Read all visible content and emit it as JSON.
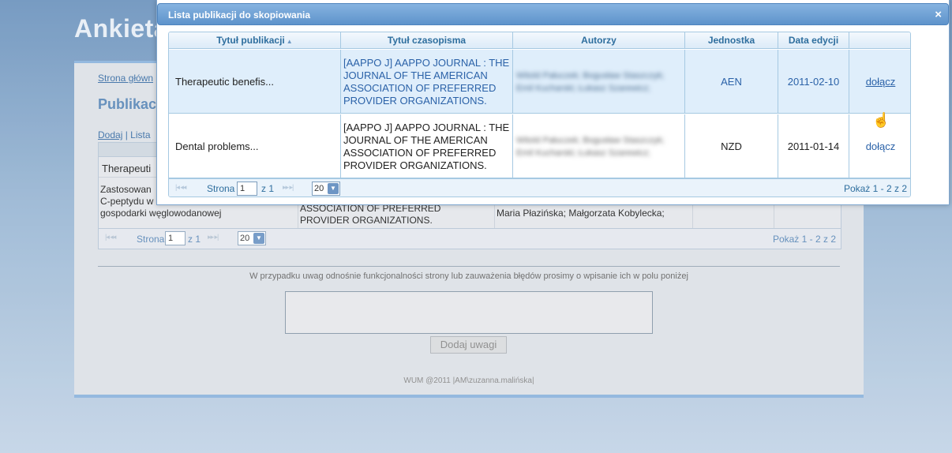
{
  "background": {
    "app_title": "Ankieta",
    "breadcrumb": "Strona główn",
    "heading": "Publikac",
    "links": {
      "add": "Dodaj",
      "separator": "|",
      "list": "Lista"
    },
    "row1_text": "Therapeuti",
    "row2": {
      "col1": "Zastosowan\nC-peptydu w\ngospodarki węglowodanowej",
      "col2": "ASSOCIATION OF PREFERRED PROVIDER ORGANIZATIONS.",
      "col3": "Maria Płazińska; Małgorzata Kobylecka;"
    },
    "pager": {
      "page_label": "Strona",
      "page_value": "1",
      "of_label": "z 1",
      "page_size": "20",
      "summary": "Pokaż 1 - 2 z 2"
    },
    "feedback_note": "W przypadku uwag odnośnie funkcjonalności strony lub zauważenia błędów prosimy o wpisanie ich w polu poniżej",
    "feedback_button": "Dodaj uwagi",
    "footer": "WUM @2011  |AM\\zuzanna.malińska|"
  },
  "dialog": {
    "title": "Lista publikacji do skopiowania",
    "close_glyph": "×",
    "columns": [
      "Tytuł publikacji",
      "Tytuł czasopisma",
      "Autorzy",
      "Jednostka",
      "Data edycji",
      ""
    ],
    "sort_glyph": "▲",
    "rows": [
      {
        "publication": "Therapeutic benefis...",
        "journal": "[AAPPO J] AAPPO JOURNAL : THE JOURNAL OF THE AMERICAN ASSOCIATION OF PREFERRED PROVIDER ORGANIZATIONS.",
        "authors": "Witold Pałuczek; Bogusław Staszczyk; Emil Kucharski; Łukasz Szarewicz;",
        "unit": "AEN",
        "date": "2011-02-10",
        "action": "dołącz"
      },
      {
        "publication": "Dental problems...",
        "journal": "[AAPPO J] AAPPO JOURNAL : THE JOURNAL OF THE AMERICAN ASSOCIATION OF PREFERRED PROVIDER ORGANIZATIONS.",
        "authors": "Witold Pałuczek; Bogusław Staszczyk; Emil Kucharski; Łukasz Szarewicz;",
        "unit": "NZD",
        "date": "2011-01-14",
        "action": "dołącz"
      }
    ],
    "pager": {
      "page_label": "Strona",
      "page_value": "1",
      "of_label": "z 1",
      "page_size": "20",
      "summary": "Pokaż 1 - 2 z 2"
    }
  },
  "colors": {
    "accent": "#2e6e9e",
    "selected_row": "#dfeefb",
    "titlebar": "#5e93cb"
  }
}
